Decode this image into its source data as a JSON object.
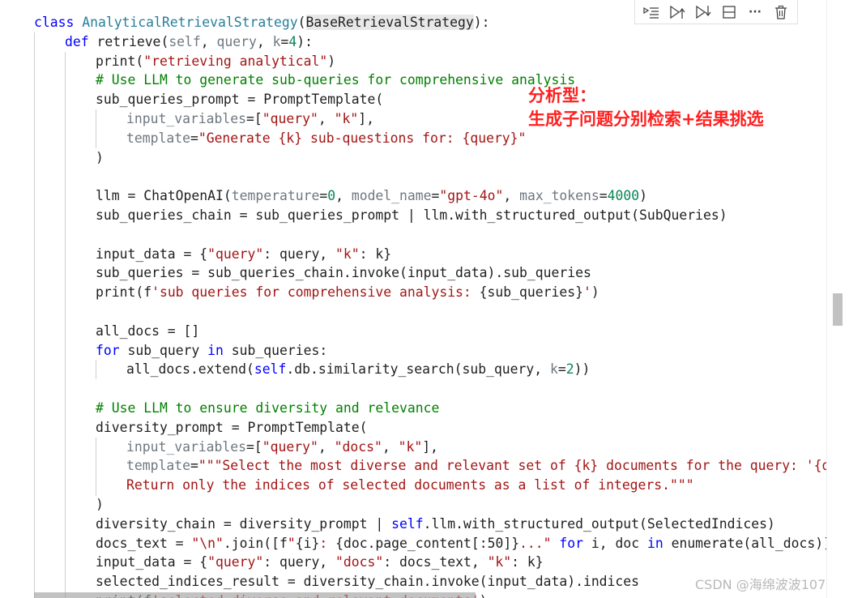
{
  "toolbar": {
    "buttons": [
      {
        "name": "run-by-line-icon"
      },
      {
        "name": "execute-above-icon"
      },
      {
        "name": "execute-below-icon"
      },
      {
        "name": "split-cell-icon"
      },
      {
        "name": "more-icon",
        "glyph": "···"
      },
      {
        "name": "delete-icon"
      }
    ]
  },
  "annotation": {
    "line1": "分析型：",
    "line2": "生成子问题分别检索+结果挑选"
  },
  "watermark": "CSDN @海绵波波107",
  "code_lines": [
    [
      0,
      [
        [
          "kw",
          "class "
        ],
        [
          "cls",
          "AnalyticalRetrievalStrategy"
        ],
        [
          "",
          "("
        ],
        [
          "hl",
          "BaseRetrievalStrategy"
        ],
        [
          "",
          "):"
        ]
      ]
    ],
    [
      1,
      [
        [
          "kw",
          "def "
        ],
        [
          "fn",
          "retrieve"
        ],
        [
          "",
          "("
        ],
        [
          "prm",
          "self"
        ],
        [
          "",
          ", "
        ],
        [
          "prm",
          "query"
        ],
        [
          "",
          ", "
        ],
        [
          "prm",
          "k"
        ],
        [
          "",
          "="
        ],
        [
          "num",
          "4"
        ],
        [
          "",
          "):"
        ]
      ]
    ],
    [
      2,
      [
        [
          "",
          "print("
        ],
        [
          "str",
          "\"retrieving analytical\""
        ],
        [
          "",
          ")"
        ]
      ]
    ],
    [
      2,
      [
        [
          "cmt",
          "# Use LLM to generate sub-queries for comprehensive analysis"
        ]
      ]
    ],
    [
      2,
      [
        [
          "",
          "sub_queries_prompt = PromptTemplate("
        ]
      ]
    ],
    [
      3,
      [
        [
          "prm",
          "input_variables"
        ],
        [
          "",
          "=["
        ],
        [
          "str",
          "\"query\""
        ],
        [
          "",
          ", "
        ],
        [
          "str",
          "\"k\""
        ],
        [
          "",
          "],"
        ]
      ]
    ],
    [
      3,
      [
        [
          "prm",
          "template"
        ],
        [
          "",
          "="
        ],
        [
          "str",
          "\"Generate {k} sub-questions for: {query}\""
        ]
      ]
    ],
    [
      2,
      [
        [
          "",
          ")"
        ]
      ]
    ],
    [
      2,
      []
    ],
    [
      2,
      [
        [
          "",
          "llm = ChatOpenAI("
        ],
        [
          "prm",
          "temperature"
        ],
        [
          "",
          "="
        ],
        [
          "num",
          "0"
        ],
        [
          "",
          ", "
        ],
        [
          "prm",
          "model_name"
        ],
        [
          "",
          "="
        ],
        [
          "str",
          "\"gpt-4o\""
        ],
        [
          "",
          ", "
        ],
        [
          "prm",
          "max_tokens"
        ],
        [
          "",
          "="
        ],
        [
          "num",
          "4000"
        ],
        [
          "",
          ")"
        ]
      ]
    ],
    [
      2,
      [
        [
          "",
          "sub_queries_chain = sub_queries_prompt | llm.with_structured_output(SubQueries)"
        ]
      ]
    ],
    [
      2,
      []
    ],
    [
      2,
      [
        [
          "",
          "input_data = {"
        ],
        [
          "str",
          "\"query\""
        ],
        [
          "",
          ": query, "
        ],
        [
          "str",
          "\"k\""
        ],
        [
          "",
          ": k}"
        ]
      ]
    ],
    [
      2,
      [
        [
          "",
          "sub_queries = sub_queries_chain.invoke(input_data).sub_queries"
        ]
      ]
    ],
    [
      2,
      [
        [
          "",
          "print(f"
        ],
        [
          "str",
          "'sub queries for comprehensive analysis: "
        ],
        [
          "",
          "{sub_queries}"
        ],
        [
          "str",
          "'"
        ],
        [
          "",
          ")"
        ]
      ]
    ],
    [
      2,
      []
    ],
    [
      2,
      [
        [
          "",
          "all_docs = []"
        ]
      ]
    ],
    [
      2,
      [
        [
          "kw",
          "for "
        ],
        [
          "",
          "sub_query "
        ],
        [
          "kw",
          "in "
        ],
        [
          "",
          "sub_queries:"
        ]
      ]
    ],
    [
      3,
      [
        [
          "",
          "all_docs.extend("
        ],
        [
          "self",
          "self"
        ],
        [
          "",
          ".db.similarity_search(sub_query, "
        ],
        [
          "prm",
          "k"
        ],
        [
          "",
          "="
        ],
        [
          "num",
          "2"
        ],
        [
          "",
          "))"
        ]
      ]
    ],
    [
      2,
      []
    ],
    [
      2,
      [
        [
          "cmt",
          "# Use LLM to ensure diversity and relevance"
        ]
      ]
    ],
    [
      2,
      [
        [
          "",
          "diversity_prompt = PromptTemplate("
        ]
      ]
    ],
    [
      3,
      [
        [
          "prm",
          "input_variables"
        ],
        [
          "",
          "=["
        ],
        [
          "str",
          "\"query\""
        ],
        [
          "",
          ", "
        ],
        [
          "str",
          "\"docs\""
        ],
        [
          "",
          ", "
        ],
        [
          "str",
          "\"k\""
        ],
        [
          "",
          "],"
        ]
      ]
    ],
    [
      3,
      [
        [
          "prm",
          "template"
        ],
        [
          "",
          "="
        ],
        [
          "str",
          "\"\"\"Select the most diverse and relevant set of {k} documents for the query: '{query}'"
        ]
      ]
    ],
    [
      3,
      [
        [
          "str",
          "Return only the indices of selected documents as a list of integers.\"\"\""
        ]
      ]
    ],
    [
      2,
      [
        [
          "",
          ")"
        ]
      ]
    ],
    [
      2,
      [
        [
          "",
          "diversity_chain = diversity_prompt | "
        ],
        [
          "self",
          "self"
        ],
        [
          "",
          ".llm.with_structured_output(SelectedIndices)"
        ]
      ]
    ],
    [
      2,
      [
        [
          "",
          "docs_text = "
        ],
        [
          "str",
          "\"\\n\""
        ],
        [
          "",
          ".join([f"
        ],
        [
          "str",
          "\""
        ],
        [
          "",
          "{i}"
        ],
        [
          "str",
          ": "
        ],
        [
          "",
          "{doc.page_content[:50]}"
        ],
        [
          "str",
          "...\""
        ],
        [
          "kw",
          " for "
        ],
        [
          "",
          "i, doc "
        ],
        [
          "kw",
          "in "
        ],
        [
          "",
          "enumerate(all_docs)])"
        ]
      ]
    ],
    [
      2,
      [
        [
          "",
          "input_data = {"
        ],
        [
          "str",
          "\"query\""
        ],
        [
          "",
          ": query, "
        ],
        [
          "str",
          "\"docs\""
        ],
        [
          "",
          ": docs_text, "
        ],
        [
          "str",
          "\"k\""
        ],
        [
          "",
          ": k}"
        ]
      ]
    ],
    [
      2,
      [
        [
          "",
          "selected_indices_result = diversity_chain.invoke(input_data).indices"
        ]
      ]
    ],
    [
      2,
      [
        [
          "",
          "print(f"
        ],
        [
          "str",
          "'selected diverse and relevant documents'"
        ],
        [
          "",
          ")"
        ]
      ]
    ]
  ]
}
